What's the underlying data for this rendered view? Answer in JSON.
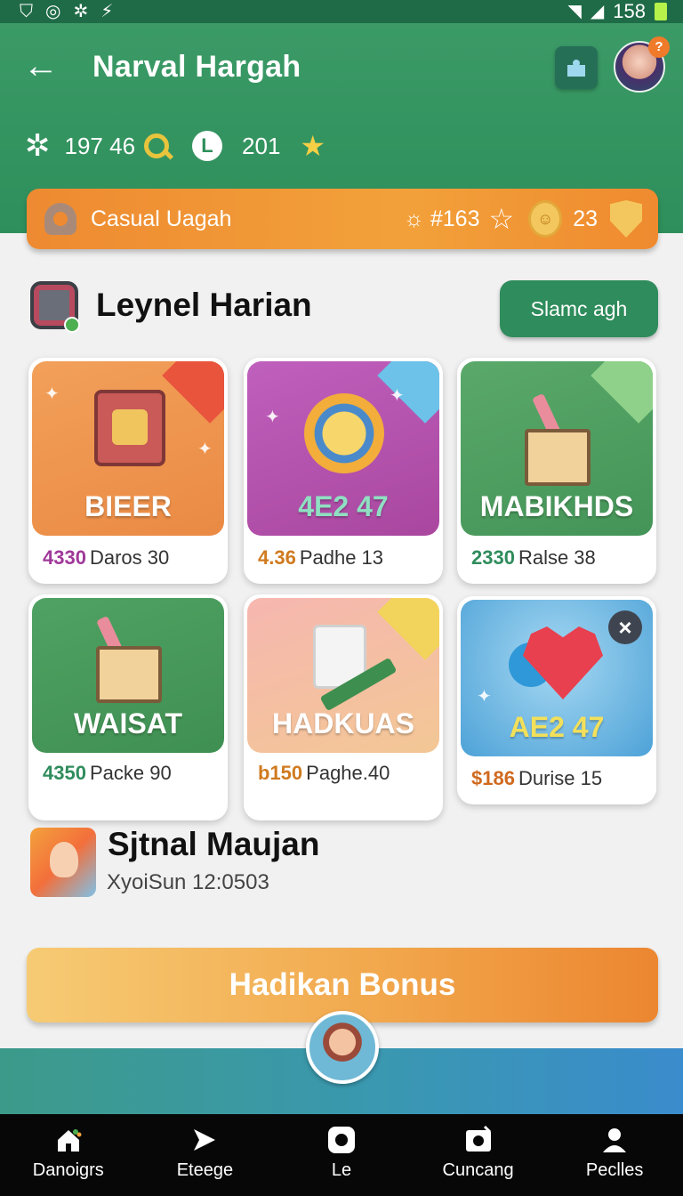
{
  "status_bar": {
    "left_icons": [
      "shield-icon",
      "target-icon",
      "spark-icon",
      "signal-spark-icon"
    ],
    "right_text": "158",
    "right_icons": [
      "wifi-icon",
      "cell-signal-icon",
      "battery-icon"
    ]
  },
  "header": {
    "title": "Narval Hargah",
    "stats": {
      "score": "197 46",
      "level": "201"
    }
  },
  "category_bar": {
    "label": "Casual Uagah",
    "stat1": "#163",
    "stat2": "23"
  },
  "section": {
    "title": "Leynel Harian",
    "action_label": "Slamc agh"
  },
  "cards": [
    {
      "name": "BIEER",
      "price": "4330",
      "desc": "Daros 30",
      "price_color": "#a0399a"
    },
    {
      "name": "4E2 47",
      "price": "4.36",
      "desc": "Padhe 13",
      "price_color": "#d07a1f"
    },
    {
      "name": "MABIKHDS",
      "price": "2330",
      "desc": "Ralse 38",
      "price_color": "#2f8c5c"
    },
    {
      "name": "WAISAT",
      "price": "4350",
      "desc": "Packe 90",
      "price_color": "#2f8c5c"
    },
    {
      "name": "HADKUAS",
      "price": "b150",
      "desc": "Paghe.40",
      "price_color": "#d07a1f"
    },
    {
      "name": "AE2 47",
      "price": "$186",
      "desc": "Durise 15",
      "price_color": "#d06a1f"
    }
  ],
  "player": {
    "name": "Sjtnal  Maujan",
    "subtitle": "XyoiSun 12:0503"
  },
  "bonus_button": "Hadikan Bonus",
  "nav": [
    {
      "label": "Danoigrs",
      "icon": "home-icon"
    },
    {
      "label": "Eteege",
      "icon": "arrow-icon"
    },
    {
      "label": "Le",
      "icon": "record-icon"
    },
    {
      "label": "Cuncang",
      "icon": "camera-icon"
    },
    {
      "label": "Peclles",
      "icon": "profile-icon"
    }
  ],
  "colors": {
    "header_green": "#2e8f5c",
    "accent_orange": "#ee8a31",
    "card_orange": "#ef9a4c",
    "card_purple": "#b452b3",
    "card_green": "#4a9e60",
    "card_pink": "#f6b0a4",
    "card_blue": "#5aaede"
  }
}
